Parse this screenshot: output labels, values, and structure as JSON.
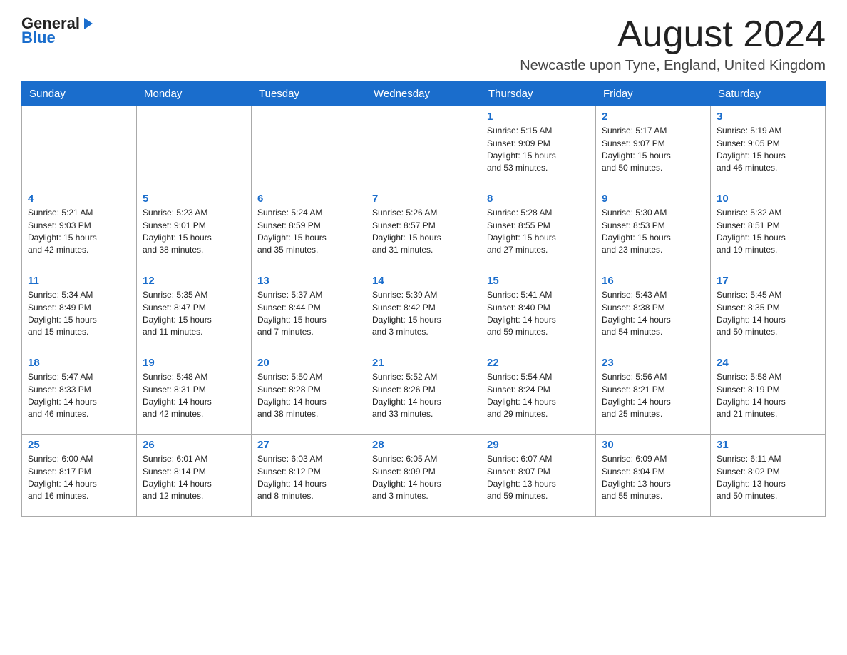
{
  "header": {
    "logo_general": "General",
    "logo_blue": "Blue",
    "month_title": "August 2024",
    "location": "Newcastle upon Tyne, England, United Kingdom"
  },
  "days_of_week": [
    "Sunday",
    "Monday",
    "Tuesday",
    "Wednesday",
    "Thursday",
    "Friday",
    "Saturday"
  ],
  "weeks": [
    [
      {
        "day": "",
        "info": ""
      },
      {
        "day": "",
        "info": ""
      },
      {
        "day": "",
        "info": ""
      },
      {
        "day": "",
        "info": ""
      },
      {
        "day": "1",
        "info": "Sunrise: 5:15 AM\nSunset: 9:09 PM\nDaylight: 15 hours\nand 53 minutes."
      },
      {
        "day": "2",
        "info": "Sunrise: 5:17 AM\nSunset: 9:07 PM\nDaylight: 15 hours\nand 50 minutes."
      },
      {
        "day": "3",
        "info": "Sunrise: 5:19 AM\nSunset: 9:05 PM\nDaylight: 15 hours\nand 46 minutes."
      }
    ],
    [
      {
        "day": "4",
        "info": "Sunrise: 5:21 AM\nSunset: 9:03 PM\nDaylight: 15 hours\nand 42 minutes."
      },
      {
        "day": "5",
        "info": "Sunrise: 5:23 AM\nSunset: 9:01 PM\nDaylight: 15 hours\nand 38 minutes."
      },
      {
        "day": "6",
        "info": "Sunrise: 5:24 AM\nSunset: 8:59 PM\nDaylight: 15 hours\nand 35 minutes."
      },
      {
        "day": "7",
        "info": "Sunrise: 5:26 AM\nSunset: 8:57 PM\nDaylight: 15 hours\nand 31 minutes."
      },
      {
        "day": "8",
        "info": "Sunrise: 5:28 AM\nSunset: 8:55 PM\nDaylight: 15 hours\nand 27 minutes."
      },
      {
        "day": "9",
        "info": "Sunrise: 5:30 AM\nSunset: 8:53 PM\nDaylight: 15 hours\nand 23 minutes."
      },
      {
        "day": "10",
        "info": "Sunrise: 5:32 AM\nSunset: 8:51 PM\nDaylight: 15 hours\nand 19 minutes."
      }
    ],
    [
      {
        "day": "11",
        "info": "Sunrise: 5:34 AM\nSunset: 8:49 PM\nDaylight: 15 hours\nand 15 minutes."
      },
      {
        "day": "12",
        "info": "Sunrise: 5:35 AM\nSunset: 8:47 PM\nDaylight: 15 hours\nand 11 minutes."
      },
      {
        "day": "13",
        "info": "Sunrise: 5:37 AM\nSunset: 8:44 PM\nDaylight: 15 hours\nand 7 minutes."
      },
      {
        "day": "14",
        "info": "Sunrise: 5:39 AM\nSunset: 8:42 PM\nDaylight: 15 hours\nand 3 minutes."
      },
      {
        "day": "15",
        "info": "Sunrise: 5:41 AM\nSunset: 8:40 PM\nDaylight: 14 hours\nand 59 minutes."
      },
      {
        "day": "16",
        "info": "Sunrise: 5:43 AM\nSunset: 8:38 PM\nDaylight: 14 hours\nand 54 minutes."
      },
      {
        "day": "17",
        "info": "Sunrise: 5:45 AM\nSunset: 8:35 PM\nDaylight: 14 hours\nand 50 minutes."
      }
    ],
    [
      {
        "day": "18",
        "info": "Sunrise: 5:47 AM\nSunset: 8:33 PM\nDaylight: 14 hours\nand 46 minutes."
      },
      {
        "day": "19",
        "info": "Sunrise: 5:48 AM\nSunset: 8:31 PM\nDaylight: 14 hours\nand 42 minutes."
      },
      {
        "day": "20",
        "info": "Sunrise: 5:50 AM\nSunset: 8:28 PM\nDaylight: 14 hours\nand 38 minutes."
      },
      {
        "day": "21",
        "info": "Sunrise: 5:52 AM\nSunset: 8:26 PM\nDaylight: 14 hours\nand 33 minutes."
      },
      {
        "day": "22",
        "info": "Sunrise: 5:54 AM\nSunset: 8:24 PM\nDaylight: 14 hours\nand 29 minutes."
      },
      {
        "day": "23",
        "info": "Sunrise: 5:56 AM\nSunset: 8:21 PM\nDaylight: 14 hours\nand 25 minutes."
      },
      {
        "day": "24",
        "info": "Sunrise: 5:58 AM\nSunset: 8:19 PM\nDaylight: 14 hours\nand 21 minutes."
      }
    ],
    [
      {
        "day": "25",
        "info": "Sunrise: 6:00 AM\nSunset: 8:17 PM\nDaylight: 14 hours\nand 16 minutes."
      },
      {
        "day": "26",
        "info": "Sunrise: 6:01 AM\nSunset: 8:14 PM\nDaylight: 14 hours\nand 12 minutes."
      },
      {
        "day": "27",
        "info": "Sunrise: 6:03 AM\nSunset: 8:12 PM\nDaylight: 14 hours\nand 8 minutes."
      },
      {
        "day": "28",
        "info": "Sunrise: 6:05 AM\nSunset: 8:09 PM\nDaylight: 14 hours\nand 3 minutes."
      },
      {
        "day": "29",
        "info": "Sunrise: 6:07 AM\nSunset: 8:07 PM\nDaylight: 13 hours\nand 59 minutes."
      },
      {
        "day": "30",
        "info": "Sunrise: 6:09 AM\nSunset: 8:04 PM\nDaylight: 13 hours\nand 55 minutes."
      },
      {
        "day": "31",
        "info": "Sunrise: 6:11 AM\nSunset: 8:02 PM\nDaylight: 13 hours\nand 50 minutes."
      }
    ]
  ]
}
